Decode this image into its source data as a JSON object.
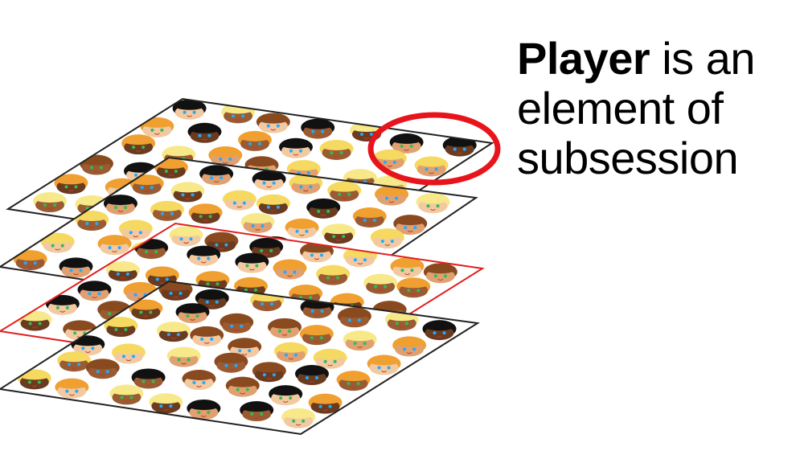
{
  "caption": {
    "bold_word": "Player",
    "line1_rest": " is an",
    "line2": "element of",
    "line3": "subsession"
  },
  "colors": {
    "sheet_border": "#222222",
    "highlight": "#e02020",
    "skin_tones": [
      "#f2c9a0",
      "#e0a070",
      "#9a5a32",
      "#6b3b1f"
    ],
    "hair_colors": [
      "#111111",
      "#f0a030",
      "#f6d960",
      "#8a4a20",
      "#f7e98a"
    ],
    "eye_colors": [
      "#22aaff",
      "#33bb55"
    ]
  },
  "icons": [
    "child-face-icon",
    "highlight-circle-icon"
  ]
}
